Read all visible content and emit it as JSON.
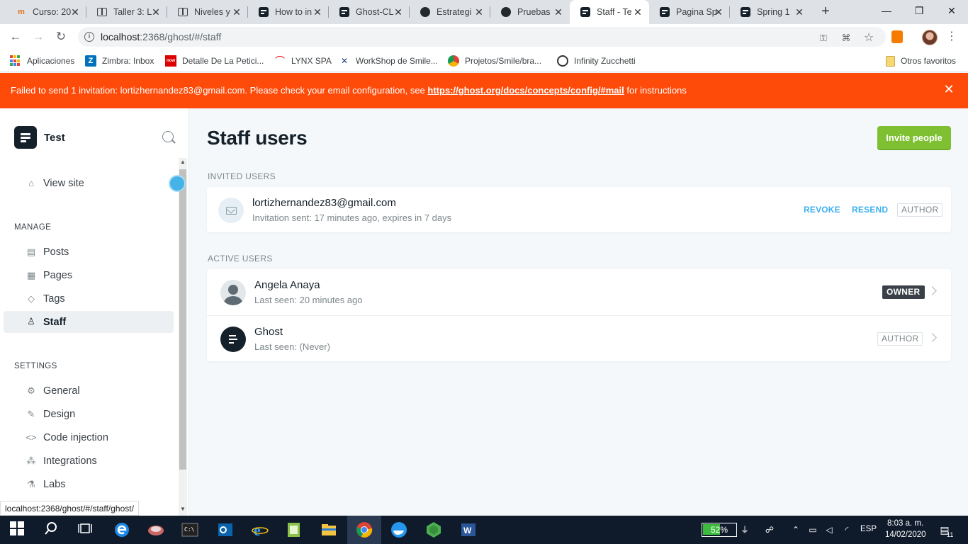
{
  "browser": {
    "tabs": [
      {
        "title": "Curso: 20",
        "icon": "m-fav",
        "close": "✕"
      },
      {
        "title": "Taller 3: L",
        "icon": "book-fav",
        "close": "✕"
      },
      {
        "title": "Niveles y",
        "icon": "book-fav",
        "close": "✕"
      },
      {
        "title": "How to in",
        "icon": "ghost-fav",
        "close": "✕"
      },
      {
        "title": "Ghost-CL",
        "icon": "ghost-fav",
        "close": "✕"
      },
      {
        "title": "Estrategi",
        "icon": "gh-fav",
        "close": "✕"
      },
      {
        "title": "Pruebas",
        "icon": "gh-fav",
        "close": "✕"
      },
      {
        "title": "Staff - Te",
        "icon": "ghost-fav",
        "close": "✕"
      },
      {
        "title": "Pagina Sp",
        "icon": "ghost-fav",
        "close": "✕"
      },
      {
        "title": "Spring 1",
        "icon": "ghost-fav",
        "close": "✕"
      }
    ],
    "new_tab": "+",
    "window": {
      "minimize": "—",
      "maximize": "❐",
      "close": "✕"
    },
    "nav": {
      "back": "←",
      "forward": "→",
      "reload": "↻"
    },
    "url_host": "localhost",
    "url_rest": ":2368/ghost/#/staff",
    "bookmarks": [
      {
        "label": "Aplicaciones",
        "icon": "apps-icon"
      },
      {
        "label": "Zimbra: Inbox",
        "icon": "zimbra-icon"
      },
      {
        "label": "Detalle De La Petici...",
        "icon": "now-icon"
      },
      {
        "label": "LYNX SPA",
        "icon": "lynx-icon"
      },
      {
        "label": "WorkShop de Smile...",
        "icon": "workshop-icon"
      },
      {
        "label": "Projetos/Smile/bra...",
        "icon": "chrome-icon"
      },
      {
        "label": "Infinity Zucchetti",
        "icon": "infinity-icon"
      },
      {
        "label": "Otros favoritos",
        "icon": "folder-icon"
      }
    ],
    "status_url": "localhost:2368/ghost/#/staff/ghost/"
  },
  "alert": {
    "message": "Failed to send 1 invitation: lortizhernandez83@gmail.com. Please check your email configuration, see ",
    "link": "https://ghost.org/docs/concepts/config/#mail",
    "suffix": " for instructions",
    "close": "✕"
  },
  "sidebar": {
    "site_name": "Test",
    "view_site": "View site",
    "manage_heading": "MANAGE",
    "manage": [
      {
        "label": "Posts",
        "icon": "posts-icon"
      },
      {
        "label": "Pages",
        "icon": "pages-icon"
      },
      {
        "label": "Tags",
        "icon": "tags-icon"
      },
      {
        "label": "Staff",
        "icon": "staff-icon"
      }
    ],
    "settings_heading": "SETTINGS",
    "settings": [
      {
        "label": "General",
        "icon": "gear-icon"
      },
      {
        "label": "Design",
        "icon": "brush-icon"
      },
      {
        "label": "Code injection",
        "icon": "code-icon"
      },
      {
        "label": "Integrations",
        "icon": "integrations-icon"
      },
      {
        "label": "Labs",
        "icon": "flask-icon"
      }
    ]
  },
  "main": {
    "title": "Staff users",
    "invite_button": "Invite people",
    "invited_heading": "INVITED USERS",
    "invited": [
      {
        "email": "lortizhernandez83@gmail.com",
        "status": "Invitation sent: 17 minutes ago, expires in 7 days",
        "revoke": "REVOKE",
        "resend": "RESEND",
        "role": "AUTHOR"
      }
    ],
    "active_heading": "ACTIVE USERS",
    "active": [
      {
        "name": "Angela Anaya",
        "last_seen": "Last seen: 20 minutes ago",
        "role": "OWNER"
      },
      {
        "name": "Ghost",
        "last_seen": "Last seen: (Never)",
        "role": "AUTHOR"
      }
    ]
  },
  "taskbar": {
    "battery": "52%",
    "language": "ESP",
    "time": "8:03 a. m.",
    "date": "14/02/2020",
    "notifications": "11"
  },
  "colors": {
    "alert": "#fe4b0a",
    "invite_button": "#7ec031",
    "link": "#3eb0ef",
    "brand": "#15212a"
  }
}
